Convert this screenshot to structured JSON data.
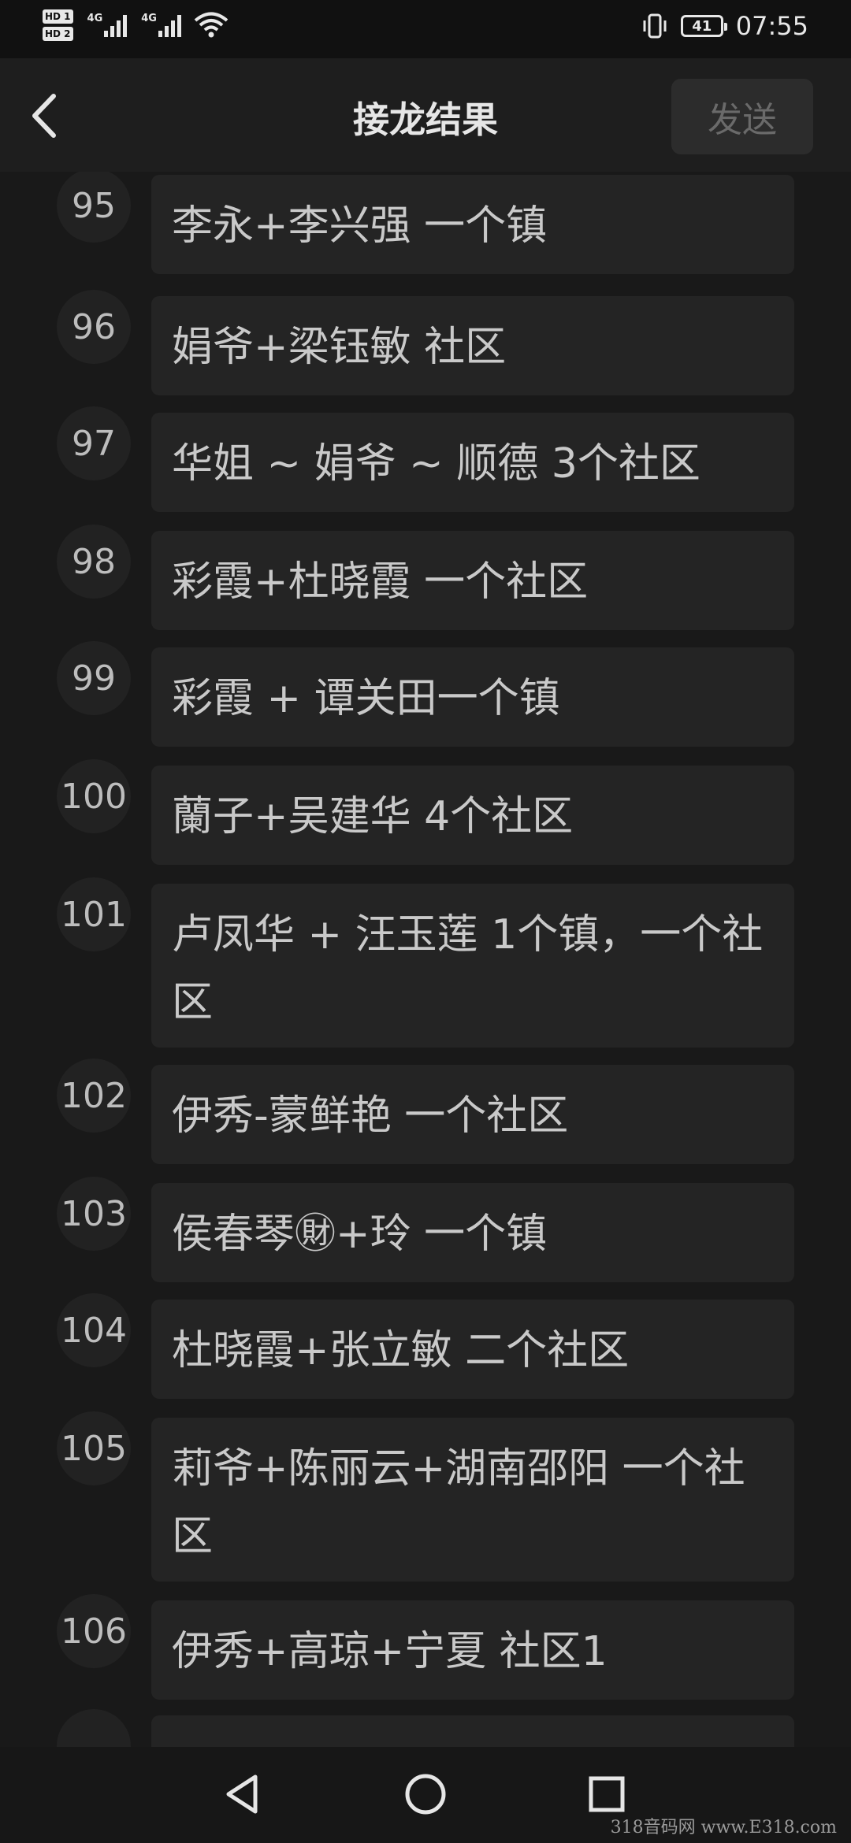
{
  "status_bar": {
    "hd1": "HD 1",
    "hd2": "HD 2",
    "net1": "4G",
    "net2": "4G",
    "battery": "41",
    "time": "07:55"
  },
  "header": {
    "title": "接龙结果",
    "send_label": "发送"
  },
  "entries": [
    {
      "num": "95",
      "text": "李永+李兴强 一个镇"
    },
    {
      "num": "96",
      "text": "娟爷+梁钰敏 社区"
    },
    {
      "num": "97",
      "text": "华姐 ~ 娟爷 ~ 顺德 3个社区"
    },
    {
      "num": "98",
      "text": "彩霞+杜晓霞 一个社区"
    },
    {
      "num": "99",
      "text": "彩霞 + 谭关田一个镇"
    },
    {
      "num": "100",
      "text": "蘭子+吴建华 4个社区"
    },
    {
      "num": "101",
      "text": "卢凤华 + 汪玉莲 1个镇，一个社区"
    },
    {
      "num": "102",
      "text": "伊秀-蒙鲜艳 一个社区"
    },
    {
      "num": "103",
      "text": "侯春琴㊖+玲 一个镇"
    },
    {
      "num": "104",
      "text": "杜晓霞+张立敏 二个社区"
    },
    {
      "num": "105",
      "text": "莉爷+陈丽云+湖南邵阳 一个社区"
    },
    {
      "num": "106",
      "text": "伊秀+高琼+宁夏 社区1"
    }
  ],
  "nav": {
    "back": "back-triangle-icon",
    "home": "home-circle-icon",
    "recents": "recents-square-icon"
  },
  "watermark": "318音码网 www.E318.com"
}
